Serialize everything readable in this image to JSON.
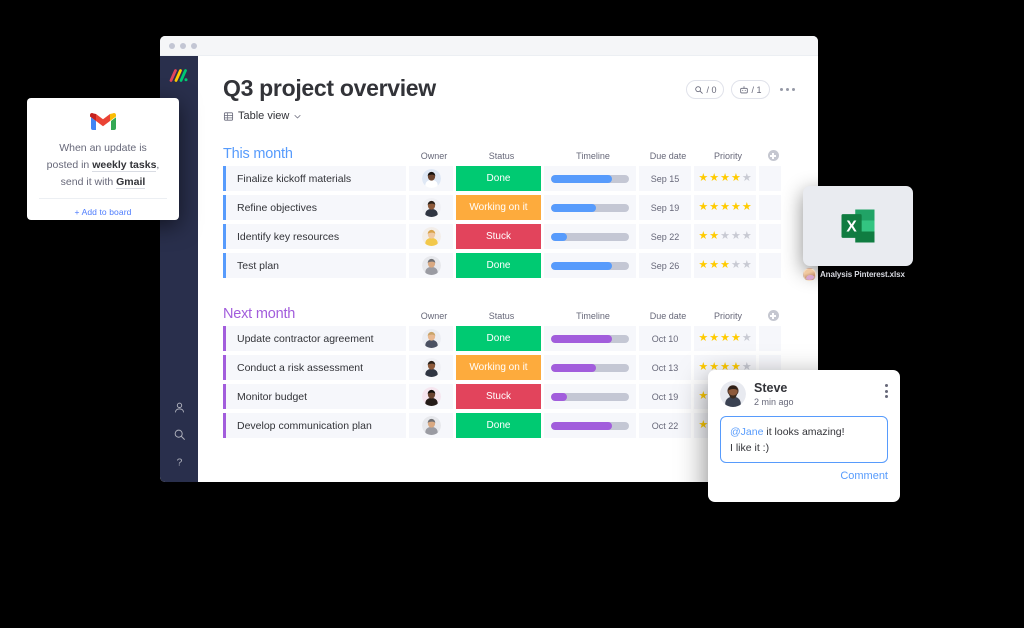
{
  "window": {
    "title_dots": 3,
    "board_title": "Q3 project overview",
    "view_label": "Table view",
    "pills": [
      {
        "icon": "search-activity-icon",
        "count": "/ 0"
      },
      {
        "icon": "automation-robot-icon",
        "count": "/ 1"
      }
    ]
  },
  "sidebar": {
    "logo": "monday-logo",
    "items": [
      {
        "icon": "person-icon"
      },
      {
        "icon": "search-icon"
      },
      {
        "icon": "help-question-icon"
      }
    ]
  },
  "columns": [
    "Owner",
    "Status",
    "Timeline",
    "Due date",
    "Priority"
  ],
  "colors": {
    "done": "#00ca72",
    "working": "#fdab3d",
    "stuck": "#e2445c",
    "group_blue": "#579bfc",
    "group_purple": "#a25ddc",
    "star_on": "#ffcb00",
    "star_off": "#c8cad3",
    "link": "#579bfc"
  },
  "groups": [
    {
      "title": "This month",
      "color": "#579bfc",
      "rows": [
        {
          "name": "Finalize kickoff materials",
          "owner": "avatar-woman-dark",
          "status": "Done",
          "status_color": "#00ca72",
          "progress": 78,
          "due": "Sep 15",
          "priority": 4
        },
        {
          "name": "Refine objectives",
          "owner": "avatar-man-beard",
          "status": "Working on it",
          "status_color": "#fdab3d",
          "progress": 58,
          "due": "Sep 19",
          "priority": 5
        },
        {
          "name": "Identify key resources",
          "owner": "avatar-woman-blond",
          "status": "Stuck",
          "status_color": "#e2445c",
          "progress": 20,
          "due": "Sep 22",
          "priority": 2
        },
        {
          "name": "Test plan",
          "owner": "avatar-man-gray",
          "status": "Done",
          "status_color": "#00ca72",
          "progress": 78,
          "due": "Sep 26",
          "priority": 3
        }
      ]
    },
    {
      "title": "Next month",
      "color": "#a25ddc",
      "rows": [
        {
          "name": "Update contractor agreement",
          "owner": "avatar-man-blond",
          "status": "Done",
          "status_color": "#00ca72",
          "progress": 78,
          "due": "Oct 10",
          "priority": 4
        },
        {
          "name": "Conduct a risk assessment",
          "owner": "avatar-man-beard",
          "status": "Working on it",
          "status_color": "#fdab3d",
          "progress": 58,
          "due": "Oct 13",
          "priority": 4
        },
        {
          "name": "Monitor budget",
          "owner": "avatar-woman-dark2",
          "status": "Stuck",
          "status_color": "#e2445c",
          "progress": 20,
          "due": "Oct 19",
          "priority": 3
        },
        {
          "name": "Develop communication plan",
          "owner": "avatar-man-gray",
          "status": "Done",
          "status_color": "#00ca72",
          "progress": 78,
          "due": "Oct 22",
          "priority": 3
        }
      ]
    }
  ],
  "gmail_card": {
    "icon": "gmail-icon",
    "line1": "When an update is",
    "line2_pre": "posted in ",
    "line2_bold": "weekly tasks",
    "line2_post": ",",
    "line3_pre": "send it with ",
    "line3_bold": "Gmail",
    "add_link": "+ Add to board"
  },
  "excel_card": {
    "icon": "excel-icon",
    "filename": "Analysis Pinterest.xlsx"
  },
  "comment_card": {
    "author": "Steve",
    "time": "2 min ago",
    "mention": "@Jane",
    "text_line1": " it looks amazing!",
    "text_line2": "I like it :)",
    "action": "Comment"
  }
}
